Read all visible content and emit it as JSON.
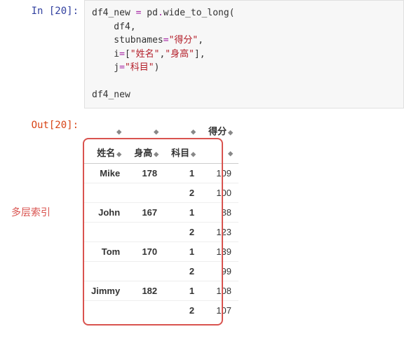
{
  "in_prompt": "In [20]:",
  "out_prompt": "Out[20]:",
  "code": {
    "l1a": "df4_new ",
    "l1b": "=",
    "l1c": " pd",
    "l1d": ".",
    "l1e": "wide_to_long(",
    "l2": "    df4,",
    "l3a": "    stubnames",
    "l3b": "=",
    "l3c": "\"得分\"",
    "l3d": ",",
    "l4a": "    i",
    "l4b": "=",
    "l4c": "[",
    "l4d": "\"姓名\"",
    "l4e": ",",
    "l4f": "\"身高\"",
    "l4g": "],",
    "l5a": "    j",
    "l5b": "=",
    "l5c": "\"科目\"",
    "l5d": ")",
    "l7": "df4_new"
  },
  "annot": "多层索引",
  "table": {
    "col_score": "得分",
    "idx1": "姓名",
    "idx2": "身高",
    "idx3": "科目",
    "rows": [
      {
        "name": "Mike",
        "height": "178",
        "subj": "1",
        "score": "109"
      },
      {
        "name": "",
        "height": "",
        "subj": "2",
        "score": "100"
      },
      {
        "name": "John",
        "height": "167",
        "subj": "1",
        "score": "88"
      },
      {
        "name": "",
        "height": "",
        "subj": "2",
        "score": "123"
      },
      {
        "name": "Tom",
        "height": "170",
        "subj": "1",
        "score": "139"
      },
      {
        "name": "",
        "height": "",
        "subj": "2",
        "score": "99"
      },
      {
        "name": "Jimmy",
        "height": "182",
        "subj": "1",
        "score": "108"
      },
      {
        "name": "",
        "height": "",
        "subj": "2",
        "score": "107"
      }
    ]
  }
}
